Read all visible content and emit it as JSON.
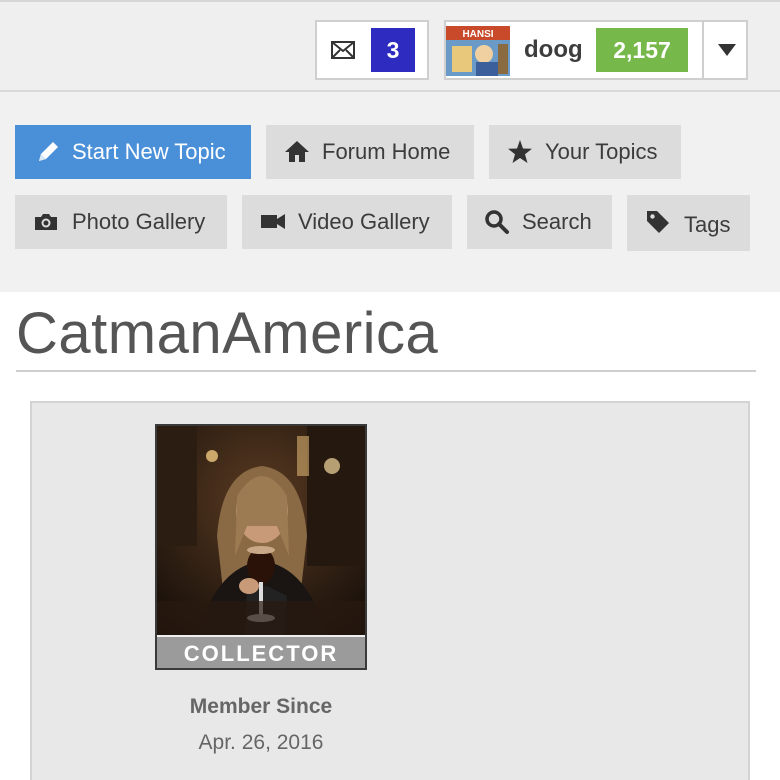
{
  "user_bar": {
    "messages_icon": "envelope-icon",
    "messages_count": "3",
    "avatar_text": "HANSI",
    "username": "doog",
    "points": "2,157",
    "menu_icon": "caret-down-icon"
  },
  "nav": {
    "buttons": [
      {
        "label": "Start New Topic",
        "icon": "pencil-icon"
      },
      {
        "label": "Forum Home",
        "icon": "home-icon"
      },
      {
        "label": "Your Topics",
        "icon": "star-icon"
      },
      {
        "label": "Photo Gallery",
        "icon": "camera-icon"
      },
      {
        "label": "Video Gallery",
        "icon": "video-camera-icon"
      },
      {
        "label": "Search",
        "icon": "search-icon"
      },
      {
        "label": "Tags",
        "icon": "tag-icon"
      }
    ]
  },
  "profile": {
    "title": "CatmanAmerica",
    "rank": "COLLECTOR",
    "member_since_label": "Member Since",
    "member_since_date": "Apr. 26, 2016"
  },
  "colors": {
    "primary": "#4a90d9",
    "messages_badge": "#2e2cc0",
    "points_badge": "#76b94a"
  }
}
